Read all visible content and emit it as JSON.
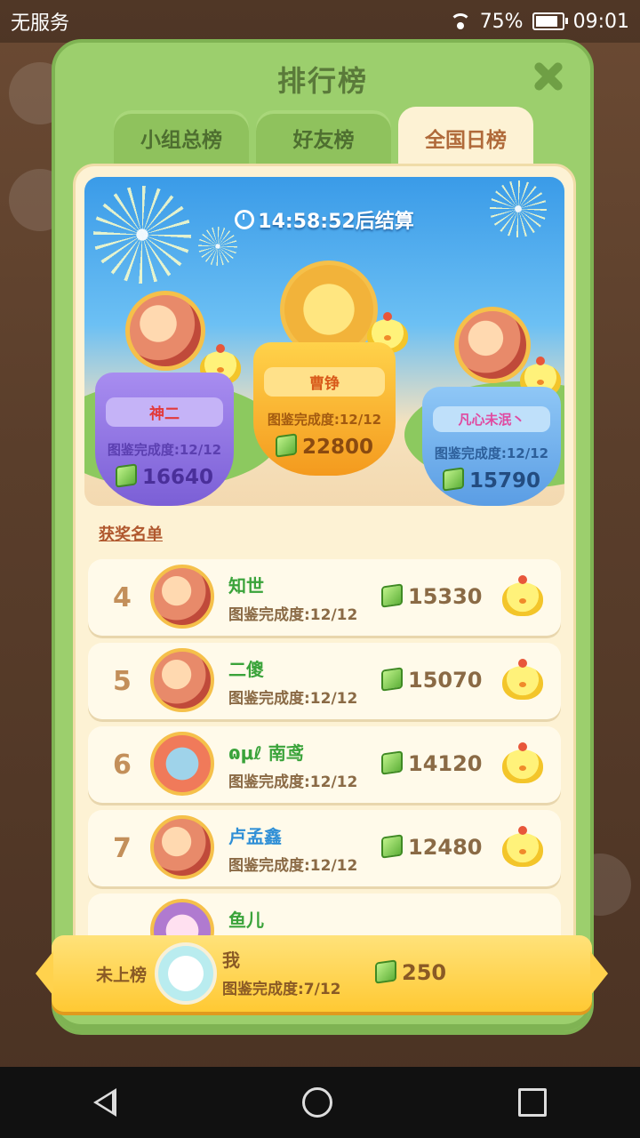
{
  "status_bar": {
    "carrier": "无服务",
    "battery": "75%",
    "battery_level": 0.75,
    "time": "09:01"
  },
  "panel": {
    "title": "排行榜",
    "tabs": [
      {
        "label": "小组总榜",
        "active": false
      },
      {
        "label": "好友榜",
        "active": false
      },
      {
        "label": "全国日榜",
        "active": true
      }
    ]
  },
  "banner": {
    "timer": "14:58:52后结算",
    "top3": [
      {
        "rank": 2,
        "name": "神二",
        "completion": "图鉴完成度:12/12",
        "score": "16640"
      },
      {
        "rank": 1,
        "name": "曹铮",
        "completion": "图鉴完成度:12/12",
        "score": "22800"
      },
      {
        "rank": 3,
        "name": "凡心未泯丶",
        "completion": "图鉴完成度:12/12",
        "score": "15790"
      }
    ]
  },
  "awards_title": "获奖名单",
  "rows": [
    {
      "rank": "4",
      "name": "知世",
      "completion": "图鉴完成度:12/12",
      "score": "15330"
    },
    {
      "rank": "5",
      "name": "二傻",
      "completion": "图鉴完成度:12/12",
      "score": "15070"
    },
    {
      "rank": "6",
      "name": "ɷμℓ 南鸢",
      "completion": "图鉴完成度:12/12",
      "score": "14120"
    },
    {
      "rank": "7",
      "name": "卢孟鑫",
      "completion": "图鉴完成度:12/12",
      "score": "12480"
    },
    {
      "rank": "",
      "name": "鱼儿",
      "completion": "",
      "score": ""
    }
  ],
  "me": {
    "status": "未上榜",
    "name": "我",
    "completion": "图鉴完成度:7/12",
    "score": "250"
  },
  "colors": {
    "accent_green": "#9ccf6d",
    "panel_cream": "#fdf2d4",
    "gold": "#ffc933"
  }
}
